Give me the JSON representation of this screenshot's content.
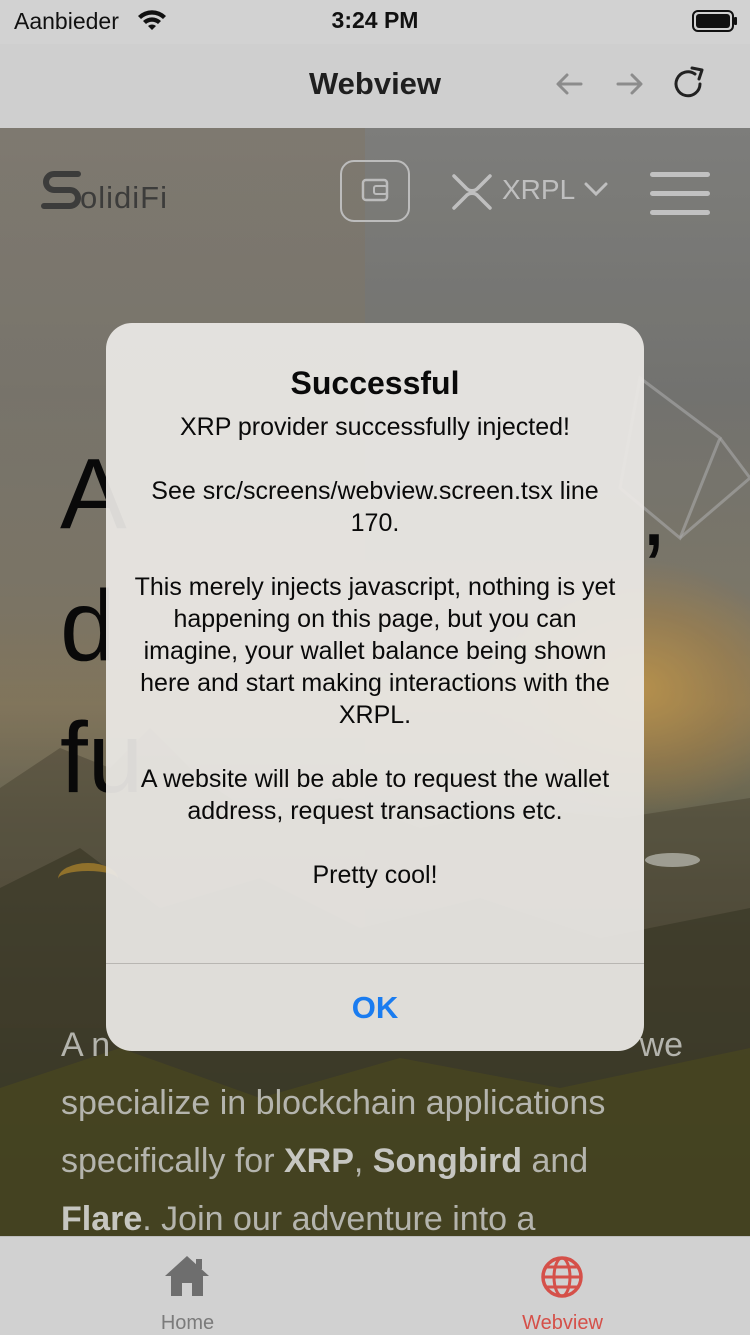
{
  "status_bar": {
    "carrier": "Aanbieder",
    "time": "3:24 PM"
  },
  "nav": {
    "title": "Webview",
    "back_icon": "arrow-left-icon",
    "forward_icon": "arrow-right-icon",
    "reload_icon": "reload-icon"
  },
  "web": {
    "logo_text": "olidiFi",
    "network_label": "XRPL",
    "hero_lines": [
      "A",
      "d",
      "fu"
    ],
    "hero_right": ",",
    "body_line1": "A n",
    "body_line1_right": "we",
    "body_line2": "specialize in blockchain applications",
    "body_line3_pre": "specifically for ",
    "xrp": "XRP",
    "comma": ", ",
    "songbird": "Songbird",
    "and": " and",
    "flare": "Flare",
    "body_line4_post": ". Join our adventure into a"
  },
  "alert": {
    "title": "Successful",
    "msg1": "XRP provider successfully injected!",
    "msg2": "See src/screens/webview.screen.tsx line 170.",
    "msg3": "This merely injects javascript, nothing is yet happening on this page, but you can imagine, your wallet balance being shown here and start making interactions with the XRPL.",
    "msg4": "A website will be able to request the wallet address, request transactions etc.",
    "msg5": "Pretty cool!",
    "ok": "OK"
  },
  "tabs": [
    {
      "label": "Home",
      "icon": "home-icon",
      "active": false
    },
    {
      "label": "Webview",
      "icon": "globe-icon",
      "active": true
    }
  ],
  "colors": {
    "accent_ok": "#1a7cf0",
    "tab_active": "#d55049",
    "tab_inactive": "#7b7b7b"
  }
}
